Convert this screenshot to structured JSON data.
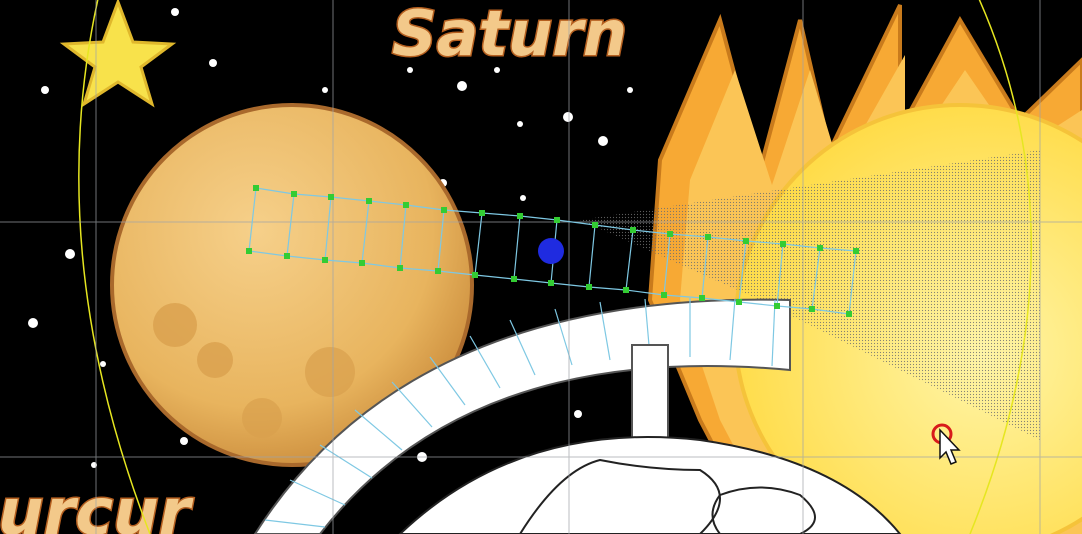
{
  "scene": {
    "title_top": "Saturn",
    "title_bottom_partial": "urcur",
    "colors": {
      "background": "#000000",
      "planet": "#E8B45E",
      "sun": "#FFE66A",
      "sun_rays": "#F7A934",
      "star": "#F8E24B",
      "mesh_handle": "#33CC33",
      "mesh_line": "#7EC8E3",
      "pivot": "#1F2BE0",
      "guide_circle": "#E6E620",
      "grid": "#9FA3A8",
      "cursor_marker": "#D81B1B"
    }
  },
  "tools": {
    "warp_mesh": "mesh-warp-icon",
    "pivot": "pivot-point-icon",
    "cursor": "arrow-cursor-icon",
    "globe_icon": "globe-icon"
  }
}
